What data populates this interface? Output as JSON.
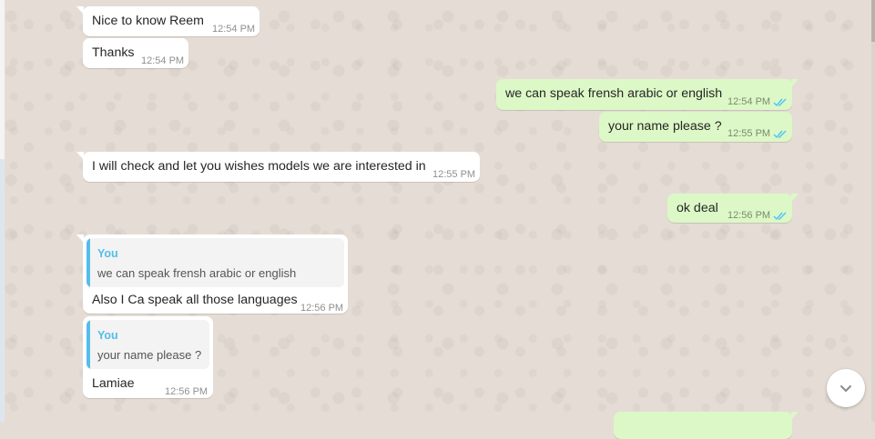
{
  "messages": [
    {
      "id": "m1",
      "dir": "in",
      "text": "Nice to know Reem",
      "time": "12:54 PM"
    },
    {
      "id": "m2",
      "dir": "in",
      "text": "Thanks",
      "time": "12:54 PM"
    },
    {
      "id": "m3",
      "dir": "out",
      "text": "we can speak frensh arabic or english",
      "time": "12:54 PM",
      "status": "read"
    },
    {
      "id": "m4",
      "dir": "out",
      "text": "your name please ?",
      "time": "12:55 PM",
      "status": "read"
    },
    {
      "id": "m5",
      "dir": "in",
      "text": "I will check and let you wishes models we are interested in",
      "time": "12:55 PM"
    },
    {
      "id": "m6",
      "dir": "out",
      "text": "ok deal",
      "time": "12:56 PM",
      "status": "read"
    },
    {
      "id": "m7",
      "dir": "in",
      "text": "Also I Ca speak all those languages",
      "time": "12:56 PM",
      "quote": {
        "author": "You",
        "text": "we can speak frensh arabic or english"
      }
    },
    {
      "id": "m8",
      "dir": "in",
      "text": "Lamiae",
      "time": "12:56 PM",
      "quote": {
        "author": "You",
        "text": "your name please ?"
      }
    }
  ],
  "colors": {
    "incoming": "#ffffff",
    "outgoing": "#dcf8c6",
    "read_tick": "#4fc3f7",
    "quote_author": "#53bdeb",
    "background": "#e5ddd5"
  },
  "icons": {
    "read_receipt": "double-check-icon",
    "scroll_down": "chevron-down-icon"
  }
}
